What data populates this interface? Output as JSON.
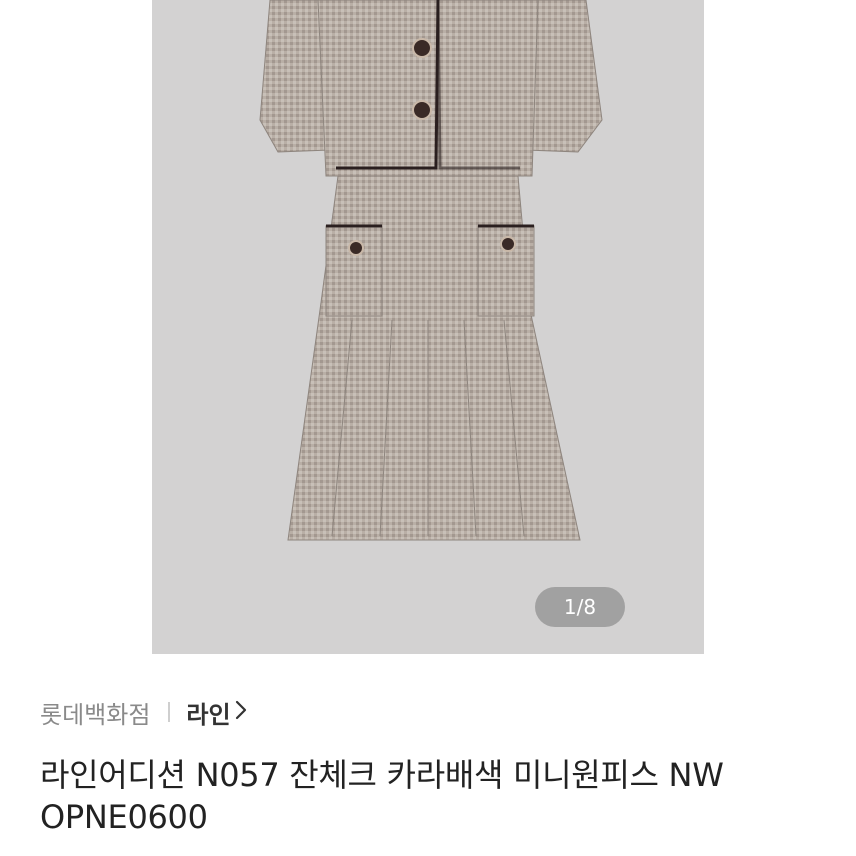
{
  "product_image": {
    "subject": "dress-photo",
    "background_color": "#d3d2d2",
    "pager": "1/8"
  },
  "seller": {
    "store": "롯데백화점",
    "brand": "라인",
    "brand_chevron_icon": "chevron-right-icon"
  },
  "product": {
    "title": "라인어디션 N057 잔체크 카라배색 미니원피스 NW OPNE0600"
  }
}
